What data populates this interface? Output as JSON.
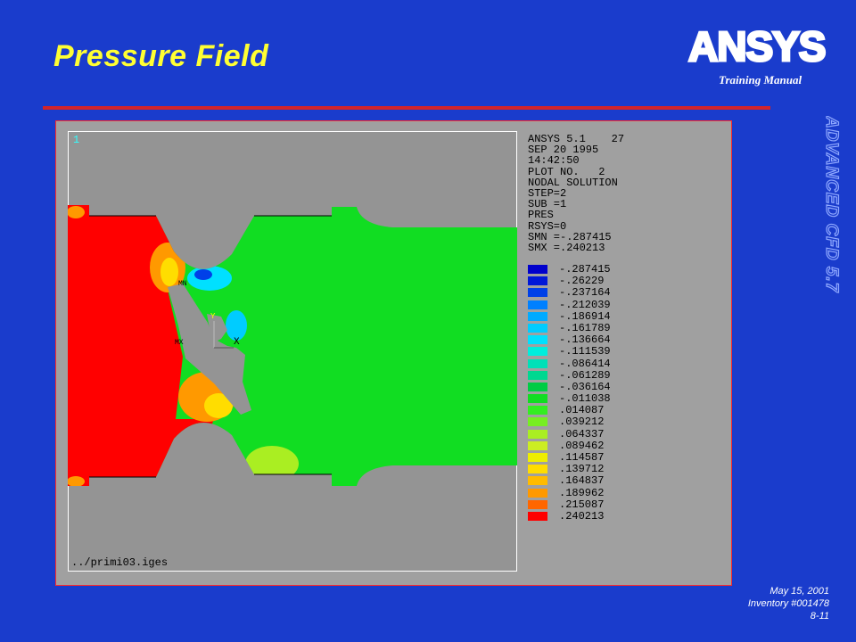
{
  "slide": {
    "title": "Pressure Field",
    "logo_text": "ANSYS",
    "subtitle": "Training Manual",
    "vertical_text": "ADVANCED CFD 5.7",
    "footer": {
      "date": "May 15, 2001",
      "inventory": "Inventory #001478",
      "page": "8-11"
    }
  },
  "plot": {
    "window_number": "1",
    "file_label": "../primi03.iges",
    "info_lines": [
      "ANSYS 5.1    27",
      "SEP 20 1995",
      "14:42:50",
      "PLOT NO.   2",
      "NODAL SOLUTION",
      "STEP=2",
      "SUB =1",
      "PRES",
      "RSYS=0",
      "SMN =-.287415",
      "SMX =.240213"
    ],
    "markers": {
      "mn": "MN",
      "mx": "MX",
      "axis_x": "X",
      "axis_y": "Y"
    },
    "legend": [
      {
        "value": "-.287415",
        "color": "#0000cc"
      },
      {
        "value": "-.26229",
        "color": "#0018d8"
      },
      {
        "value": "-.237164",
        "color": "#0040e8"
      },
      {
        "value": "-.212039",
        "color": "#0080ff"
      },
      {
        "value": "-.186914",
        "color": "#00aaff"
      },
      {
        "value": "-.161789",
        "color": "#00ccff"
      },
      {
        "value": "-.136664",
        "color": "#00e0ff"
      },
      {
        "value": "-.111539",
        "color": "#00eedd"
      },
      {
        "value": "-.086414",
        "color": "#00e0b8"
      },
      {
        "value": "-.061289",
        "color": "#00d890"
      },
      {
        "value": "-.036164",
        "color": "#00cc44"
      },
      {
        "value": "-.011038",
        "color": "#11dd22"
      },
      {
        "value": ".014087",
        "color": "#33ee22"
      },
      {
        "value": ".039212",
        "color": "#77ee22"
      },
      {
        "value": ".064337",
        "color": "#aaee22"
      },
      {
        "value": ".089462",
        "color": "#ccee22"
      },
      {
        "value": ".114587",
        "color": "#eeee00"
      },
      {
        "value": ".139712",
        "color": "#ffdd00"
      },
      {
        "value": ".164837",
        "color": "#ffbb00"
      },
      {
        "value": ".189962",
        "color": "#ff9900"
      },
      {
        "value": ".215087",
        "color": "#ff6600"
      },
      {
        "value": ".240213",
        "color": "#ff0000"
      }
    ]
  }
}
